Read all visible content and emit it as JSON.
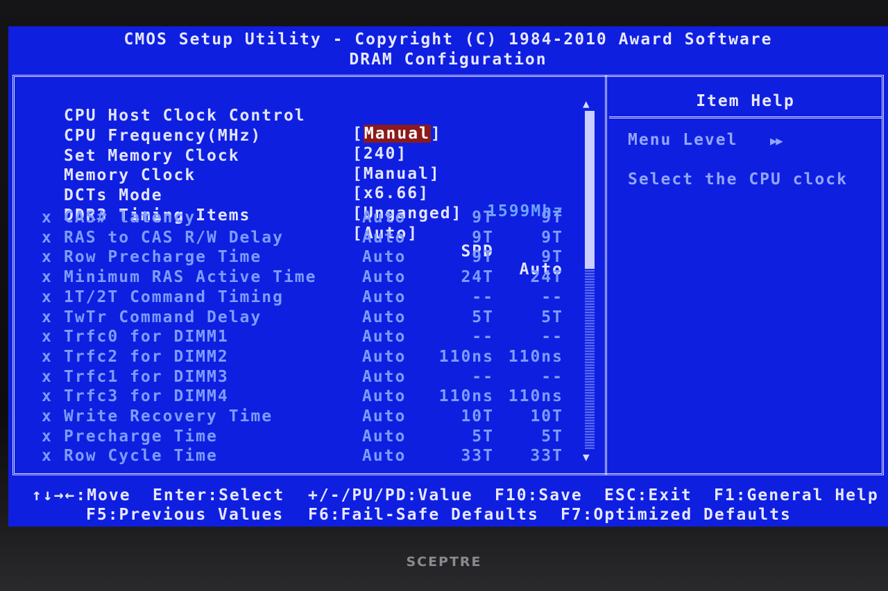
{
  "header": {
    "title": "CMOS Setup Utility - Copyright (C) 1984-2010 Award Software",
    "subtitle": "DRAM Configuration"
  },
  "settings": [
    {
      "label": "CPU Host Clock Control",
      "value": "[Manual]",
      "selected": true
    },
    {
      "label": "CPU Frequency(MHz)",
      "value": "[240]"
    },
    {
      "label": "Set Memory Clock",
      "value": "[Manual]"
    },
    {
      "label": "Memory Clock",
      "value": "[x6.66]",
      "extra": "1599Mhz"
    },
    {
      "label": "DCTs Mode",
      "value": "[Unganged]"
    },
    {
      "label": "DDR3 Timing Items",
      "value": "[Auto]",
      "spd": "SPD",
      "auto": "Auto"
    }
  ],
  "timings": [
    {
      "mark": "x",
      "label": "CAS# latency",
      "value": "Auto",
      "spd": "9T",
      "auto": "9T"
    },
    {
      "mark": "x",
      "label": "RAS to CAS R/W Delay",
      "value": "Auto",
      "spd": "9T",
      "auto": "9T"
    },
    {
      "mark": "x",
      "label": "Row Precharge Time",
      "value": "Auto",
      "spd": "9T",
      "auto": "9T"
    },
    {
      "mark": "x",
      "label": "Minimum RAS Active Time",
      "value": "Auto",
      "spd": "24T",
      "auto": "24T"
    },
    {
      "mark": "x",
      "label": "1T/2T Command Timing",
      "value": "Auto",
      "spd": "--",
      "auto": "--"
    },
    {
      "mark": "x",
      "label": "TwTr Command Delay",
      "value": "Auto",
      "spd": "5T",
      "auto": "5T"
    },
    {
      "mark": "x",
      "label": "Trfc0 for DIMM1",
      "value": "Auto",
      "spd": "--",
      "auto": "--"
    },
    {
      "mark": "x",
      "label": "Trfc2 for DIMM2",
      "value": "Auto",
      "spd": "110ns",
      "auto": "110ns"
    },
    {
      "mark": "x",
      "label": "Trfc1 for DIMM3",
      "value": "Auto",
      "spd": "--",
      "auto": "--"
    },
    {
      "mark": "x",
      "label": "Trfc3 for DIMM4",
      "value": "Auto",
      "spd": "110ns",
      "auto": "110ns"
    },
    {
      "mark": "x",
      "label": "Write Recovery Time",
      "value": "Auto",
      "spd": "10T",
      "auto": "10T"
    },
    {
      "mark": "x",
      "label": "Precharge Time",
      "value": "Auto",
      "spd": "5T",
      "auto": "5T"
    },
    {
      "mark": "x",
      "label": "Row Cycle Time",
      "value": "Auto",
      "spd": "33T",
      "auto": "33T"
    }
  ],
  "help": {
    "title": "Item Help",
    "menu_level": "Menu Level",
    "menu_level_arrows": "▶▶",
    "description": "Select the CPU clock"
  },
  "footer": {
    "move": "↑↓→←:Move",
    "enter": "Enter:Select",
    "value": "+/-/PU/PD:Value",
    "save": "F10:Save",
    "exit": "ESC:Exit",
    "help": "F1:General Help",
    "previous": "F5:Previous Values",
    "failsafe": "F6:Fail-Safe Defaults",
    "optimized": "F7:Optimized Defaults"
  },
  "monitor": {
    "brand": "SCEPTRE"
  },
  "colors": {
    "background": "#0f1fe0",
    "text": "#d8dcff",
    "disabled_text": "#7f9cff",
    "highlight": "#8b1a1a"
  }
}
